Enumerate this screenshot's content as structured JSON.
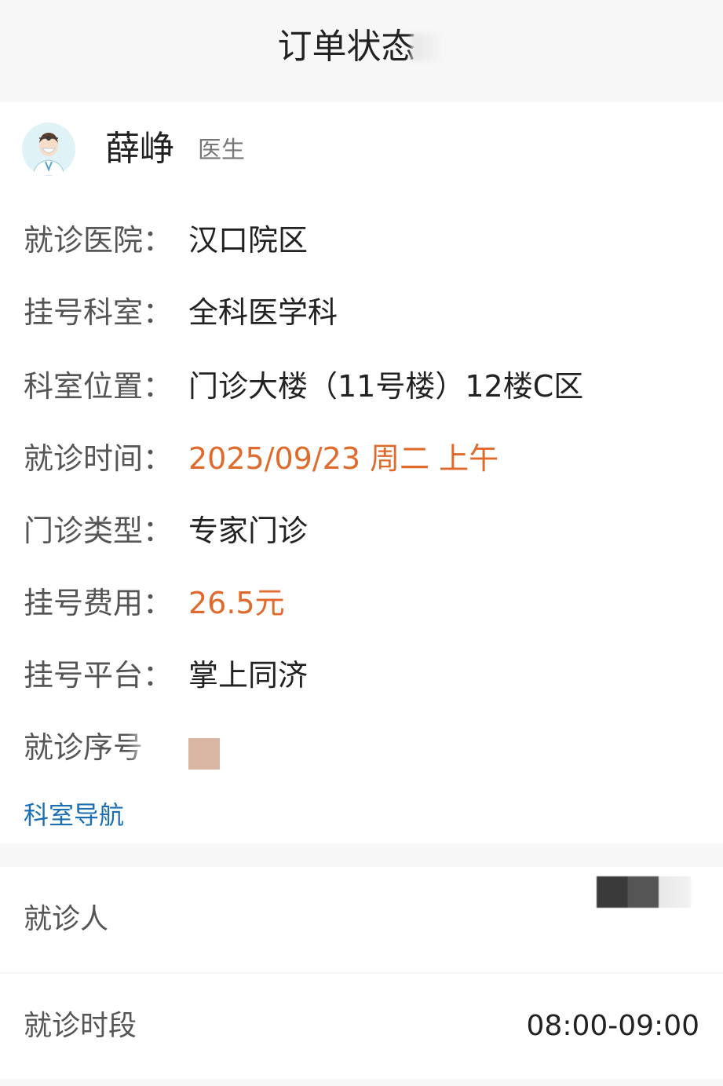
{
  "header": {
    "title": "订单状态"
  },
  "doctor": {
    "name": "薛峥",
    "role": "医生",
    "avatar_icon": "doctor-avatar-icon"
  },
  "info": {
    "hospital": {
      "label": "就诊医院：",
      "value": "汉口院区"
    },
    "department": {
      "label": "挂号科室：",
      "value": "全科医学科"
    },
    "location": {
      "label": "科室位置：",
      "value": "门诊大楼（11号楼）12楼C区"
    },
    "visit_time": {
      "label": "就诊时间：",
      "value": "2025/09/23 周二 上午"
    },
    "clinic_type": {
      "label": "门诊类型：",
      "value": "专家门诊"
    },
    "fee": {
      "label": "挂号费用：",
      "value": "26.5元"
    },
    "platform": {
      "label": "挂号平台：",
      "value": "掌上同济"
    },
    "sequence": {
      "label": "就诊序号"
    },
    "nav_link": "科室导航"
  },
  "list": {
    "patient_label": "就诊人",
    "period_label": "就诊时段",
    "period_value": "08:00-09:00"
  },
  "colors": {
    "accent": "#e06a2c",
    "link": "#1a6fb5"
  }
}
